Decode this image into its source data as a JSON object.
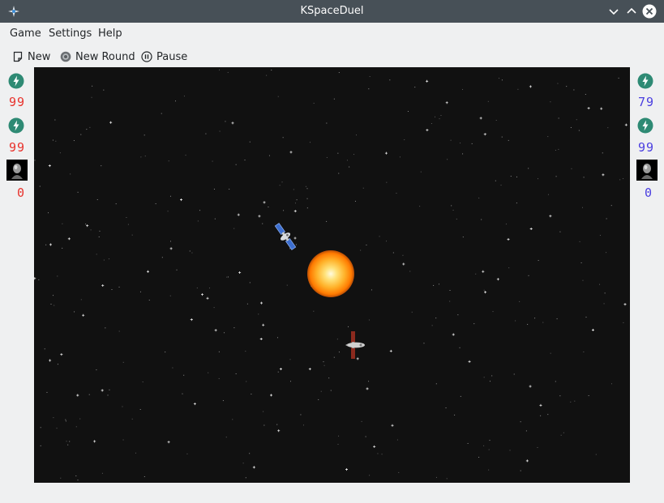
{
  "window": {
    "title": "KSpaceDuel"
  },
  "menu": {
    "items": [
      "Game",
      "Settings",
      "Help"
    ]
  },
  "toolbar": {
    "new_label": "New",
    "new_round_label": "New Round",
    "pause_label": "Pause"
  },
  "left_panel": {
    "energy_value": "99",
    "hitpoints_value": "99",
    "wins_value": "0",
    "color": "#e8322c"
  },
  "right_panel": {
    "energy_value": "79",
    "hitpoints_value": "99",
    "wins_value": "0",
    "color": "#4a3ee0"
  },
  "icons": {
    "app": "kspaceduel-icon",
    "window_buttons": [
      "chevron-down-icon",
      "chevron-up-icon",
      "close-icon"
    ],
    "toolbar": [
      "new-document-icon",
      "new-round-icon",
      "pause-icon"
    ],
    "panel": [
      "energy-icon",
      "pilot-portrait-icon"
    ]
  }
}
